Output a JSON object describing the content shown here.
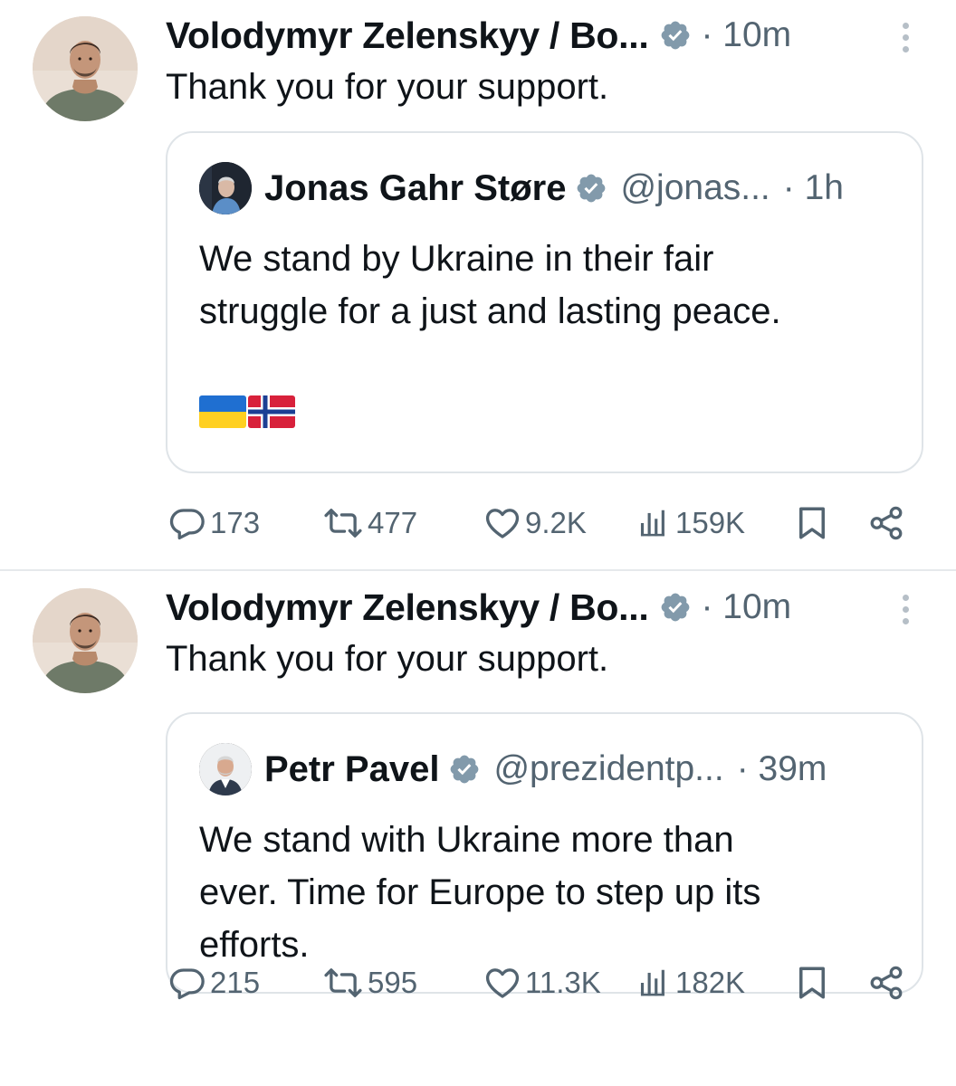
{
  "tweets": [
    {
      "author": "Volodymyr Zelenskyy / Bo...",
      "time": "· 10m",
      "text": "Thank you for your support.",
      "quote": {
        "name": "Jonas Gahr Støre",
        "handle": "@jonas...",
        "time": "· 1h",
        "lines": [
          "We stand by Ukraine in their fair",
          "struggle for a just and lasting peace."
        ],
        "flags": [
          "ukraine-flag",
          "norway-flag"
        ]
      },
      "stats": {
        "replies": "173",
        "reposts": "477",
        "likes": "9.2K",
        "views": "159K"
      }
    },
    {
      "author": "Volodymyr Zelenskyy / Bo...",
      "time": "· 10m",
      "text": "Thank you for your support.",
      "quote": {
        "name": "Petr Pavel",
        "handle": "@prezidentp...",
        "time": "· 39m",
        "lines": [
          "We stand with Ukraine more than",
          "ever. Time for Europe to step up its",
          "efforts."
        ]
      },
      "stats": {
        "replies": "215",
        "reposts": "595",
        "likes": "11.3K",
        "views": "182K"
      }
    }
  ],
  "icons": [
    "verified-badge-icon",
    "more-icon",
    "reply-icon",
    "repost-icon",
    "like-icon",
    "views-icon",
    "bookmark-icon",
    "share-icon"
  ],
  "colors": {
    "text": "#0f1419",
    "secondary": "#536471",
    "border": "#dfe4e8",
    "badge": "#829aab"
  }
}
